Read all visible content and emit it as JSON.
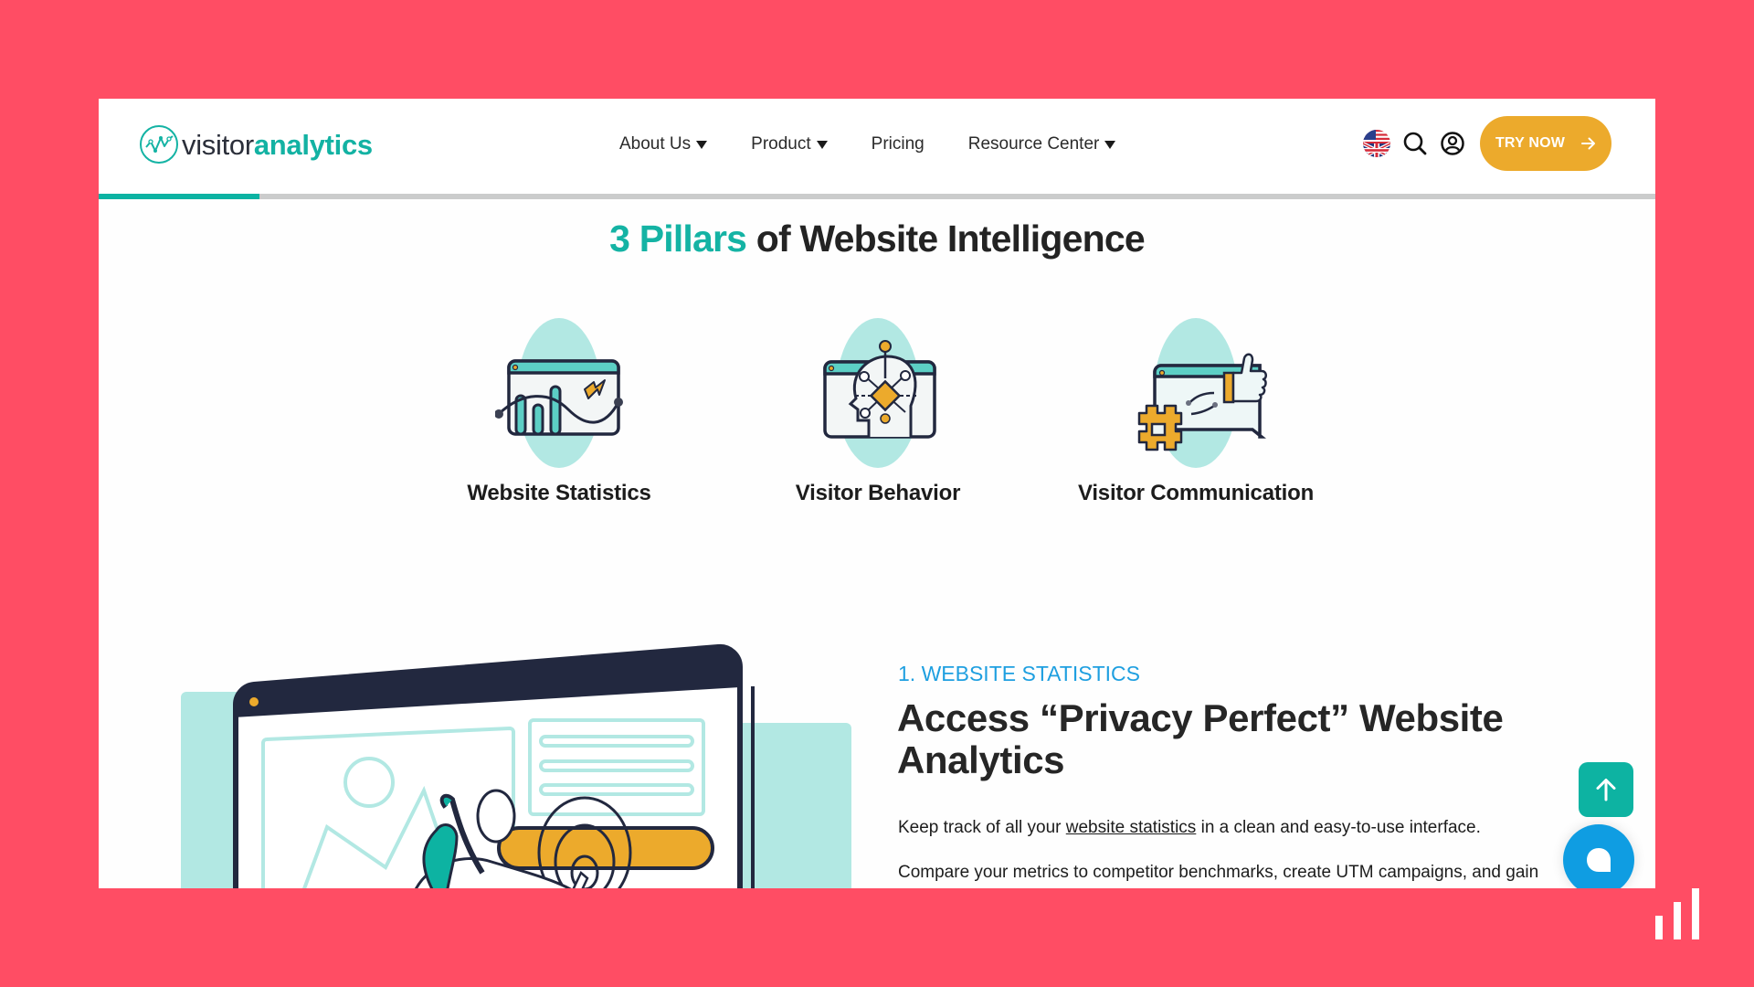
{
  "header": {
    "logo": {
      "light": "visitor",
      "bold": "analytics"
    },
    "nav": [
      {
        "label": "About Us",
        "has_dropdown": true
      },
      {
        "label": "Product",
        "has_dropdown": true
      },
      {
        "label": "Pricing",
        "has_dropdown": false
      },
      {
        "label": "Resource Center",
        "has_dropdown": true
      }
    ],
    "tools": {
      "language_icon": "us-uk-flag-icon",
      "search_icon": "search-icon",
      "account_icon": "user-circle-icon"
    },
    "cta": {
      "label": "TRY NOW",
      "icon": "arrow-right-icon"
    },
    "scroll_progress_percent": 10.3
  },
  "section": {
    "title_accent": "3 Pillars",
    "title_rest": " of Website Intelligence",
    "pillars": [
      {
        "label": "Website Statistics",
        "icon": "chart-window-icon"
      },
      {
        "label": "Visitor Behavior",
        "icon": "head-network-icon"
      },
      {
        "label": "Visitor Communication",
        "icon": "chat-thumbs-up-icon"
      }
    ]
  },
  "feature": {
    "eyebrow": "1. WEBSITE STATISTICS",
    "headline": "Access “Privacy Perfect” Website Analytics",
    "para1_before": "Keep track of all your ",
    "para1_link": "website statistics",
    "para1_after": " in a clean and easy-to-use interface.",
    "para2": "Compare your metrics to competitor benchmarks, create UTM campaigns, and gain"
  },
  "floating": {
    "scroll_top_icon": "arrow-up-icon",
    "chat_icon": "chat-bubble-icon"
  },
  "colors": {
    "background": "#ff4d64",
    "teal": "#14b3a4",
    "orange": "#ecaa2c",
    "blue": "#0f9de2",
    "navy": "#22283f"
  }
}
